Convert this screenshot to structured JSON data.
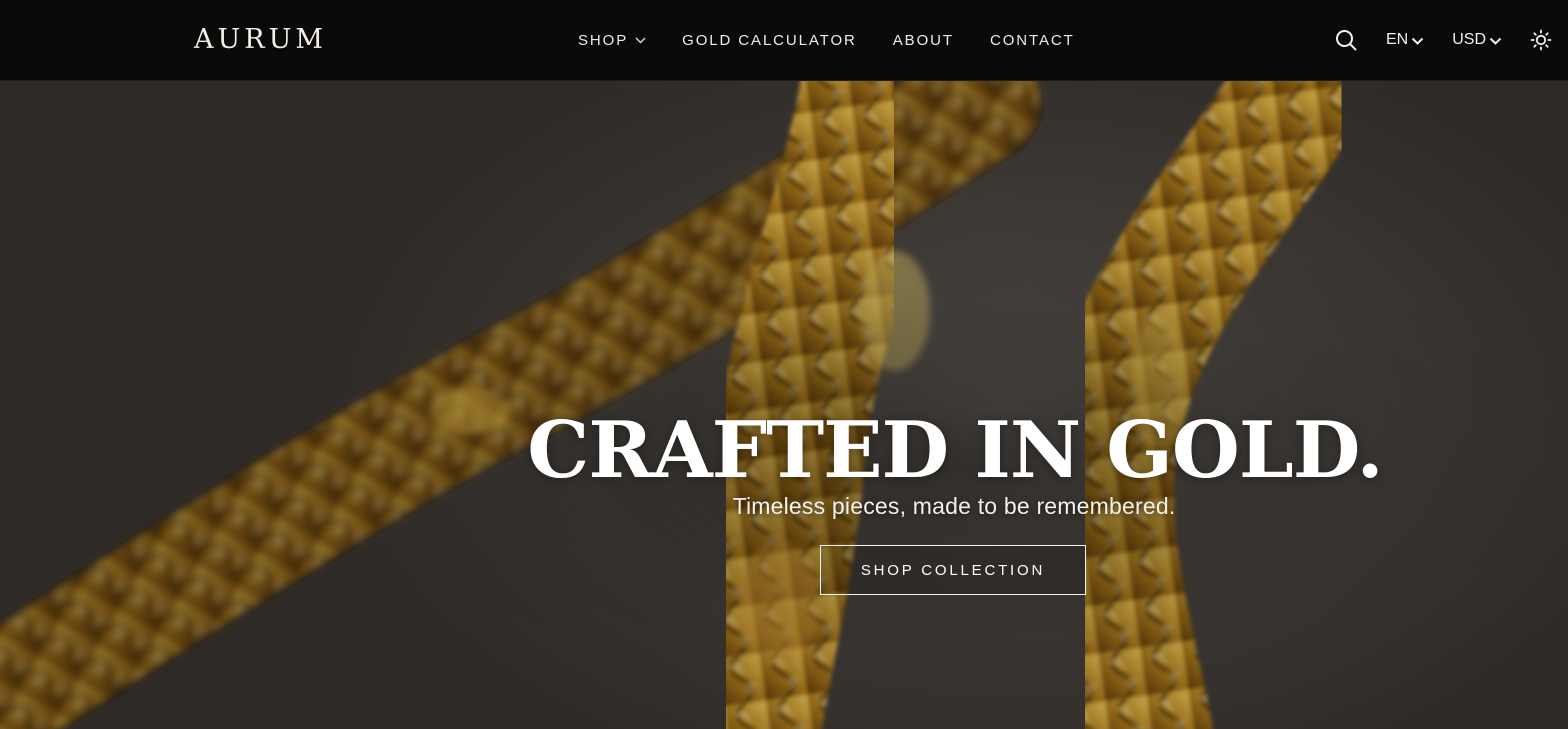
{
  "brand": {
    "logo_text": "AURUM"
  },
  "nav": {
    "items": [
      {
        "label": "SHOP",
        "has_dropdown": true,
        "icon": "chevron-down-icon"
      },
      {
        "label": "GOLD CALCULATOR"
      },
      {
        "label": "ABOUT"
      },
      {
        "label": "CONTACT"
      }
    ]
  },
  "header_actions": {
    "search_icon": "search-icon",
    "language": {
      "value": "EN",
      "icon": "chevron-down-icon"
    },
    "currency": {
      "value": "USD",
      "icon": "chevron-down-icon"
    },
    "theme_toggle_icon": "sun-icon"
  },
  "hero": {
    "title": "CRAFTED IN GOLD.",
    "subtitle": "Timeless pieces, made to be remembered.",
    "cta_label": "SHOP COLLECTION",
    "background_image": "gold-chains-photo"
  },
  "colors": {
    "header_bg": "#0a0a0a",
    "text_light": "#ffffff",
    "gold": "#c8952a",
    "hero_bg": "#4f4a45"
  }
}
